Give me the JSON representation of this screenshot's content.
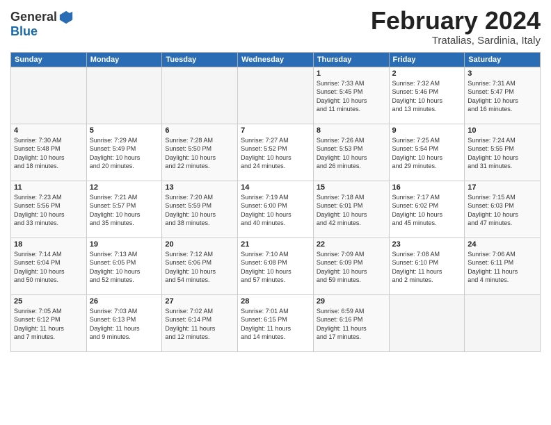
{
  "header": {
    "logo_general": "General",
    "logo_blue": "Blue",
    "month_title": "February 2024",
    "location": "Tratalias, Sardinia, Italy"
  },
  "weekdays": [
    "Sunday",
    "Monday",
    "Tuesday",
    "Wednesday",
    "Thursday",
    "Friday",
    "Saturday"
  ],
  "weeks": [
    [
      {
        "day": "",
        "info": ""
      },
      {
        "day": "",
        "info": ""
      },
      {
        "day": "",
        "info": ""
      },
      {
        "day": "",
        "info": ""
      },
      {
        "day": "1",
        "info": "Sunrise: 7:33 AM\nSunset: 5:45 PM\nDaylight: 10 hours\nand 11 minutes."
      },
      {
        "day": "2",
        "info": "Sunrise: 7:32 AM\nSunset: 5:46 PM\nDaylight: 10 hours\nand 13 minutes."
      },
      {
        "day": "3",
        "info": "Sunrise: 7:31 AM\nSunset: 5:47 PM\nDaylight: 10 hours\nand 16 minutes."
      }
    ],
    [
      {
        "day": "4",
        "info": "Sunrise: 7:30 AM\nSunset: 5:48 PM\nDaylight: 10 hours\nand 18 minutes."
      },
      {
        "day": "5",
        "info": "Sunrise: 7:29 AM\nSunset: 5:49 PM\nDaylight: 10 hours\nand 20 minutes."
      },
      {
        "day": "6",
        "info": "Sunrise: 7:28 AM\nSunset: 5:50 PM\nDaylight: 10 hours\nand 22 minutes."
      },
      {
        "day": "7",
        "info": "Sunrise: 7:27 AM\nSunset: 5:52 PM\nDaylight: 10 hours\nand 24 minutes."
      },
      {
        "day": "8",
        "info": "Sunrise: 7:26 AM\nSunset: 5:53 PM\nDaylight: 10 hours\nand 26 minutes."
      },
      {
        "day": "9",
        "info": "Sunrise: 7:25 AM\nSunset: 5:54 PM\nDaylight: 10 hours\nand 29 minutes."
      },
      {
        "day": "10",
        "info": "Sunrise: 7:24 AM\nSunset: 5:55 PM\nDaylight: 10 hours\nand 31 minutes."
      }
    ],
    [
      {
        "day": "11",
        "info": "Sunrise: 7:23 AM\nSunset: 5:56 PM\nDaylight: 10 hours\nand 33 minutes."
      },
      {
        "day": "12",
        "info": "Sunrise: 7:21 AM\nSunset: 5:57 PM\nDaylight: 10 hours\nand 35 minutes."
      },
      {
        "day": "13",
        "info": "Sunrise: 7:20 AM\nSunset: 5:59 PM\nDaylight: 10 hours\nand 38 minutes."
      },
      {
        "day": "14",
        "info": "Sunrise: 7:19 AM\nSunset: 6:00 PM\nDaylight: 10 hours\nand 40 minutes."
      },
      {
        "day": "15",
        "info": "Sunrise: 7:18 AM\nSunset: 6:01 PM\nDaylight: 10 hours\nand 42 minutes."
      },
      {
        "day": "16",
        "info": "Sunrise: 7:17 AM\nSunset: 6:02 PM\nDaylight: 10 hours\nand 45 minutes."
      },
      {
        "day": "17",
        "info": "Sunrise: 7:15 AM\nSunset: 6:03 PM\nDaylight: 10 hours\nand 47 minutes."
      }
    ],
    [
      {
        "day": "18",
        "info": "Sunrise: 7:14 AM\nSunset: 6:04 PM\nDaylight: 10 hours\nand 50 minutes."
      },
      {
        "day": "19",
        "info": "Sunrise: 7:13 AM\nSunset: 6:05 PM\nDaylight: 10 hours\nand 52 minutes."
      },
      {
        "day": "20",
        "info": "Sunrise: 7:12 AM\nSunset: 6:06 PM\nDaylight: 10 hours\nand 54 minutes."
      },
      {
        "day": "21",
        "info": "Sunrise: 7:10 AM\nSunset: 6:08 PM\nDaylight: 10 hours\nand 57 minutes."
      },
      {
        "day": "22",
        "info": "Sunrise: 7:09 AM\nSunset: 6:09 PM\nDaylight: 10 hours\nand 59 minutes."
      },
      {
        "day": "23",
        "info": "Sunrise: 7:08 AM\nSunset: 6:10 PM\nDaylight: 11 hours\nand 2 minutes."
      },
      {
        "day": "24",
        "info": "Sunrise: 7:06 AM\nSunset: 6:11 PM\nDaylight: 11 hours\nand 4 minutes."
      }
    ],
    [
      {
        "day": "25",
        "info": "Sunrise: 7:05 AM\nSunset: 6:12 PM\nDaylight: 11 hours\nand 7 minutes."
      },
      {
        "day": "26",
        "info": "Sunrise: 7:03 AM\nSunset: 6:13 PM\nDaylight: 11 hours\nand 9 minutes."
      },
      {
        "day": "27",
        "info": "Sunrise: 7:02 AM\nSunset: 6:14 PM\nDaylight: 11 hours\nand 12 minutes."
      },
      {
        "day": "28",
        "info": "Sunrise: 7:01 AM\nSunset: 6:15 PM\nDaylight: 11 hours\nand 14 minutes."
      },
      {
        "day": "29",
        "info": "Sunrise: 6:59 AM\nSunset: 6:16 PM\nDaylight: 11 hours\nand 17 minutes."
      },
      {
        "day": "",
        "info": ""
      },
      {
        "day": "",
        "info": ""
      }
    ]
  ]
}
